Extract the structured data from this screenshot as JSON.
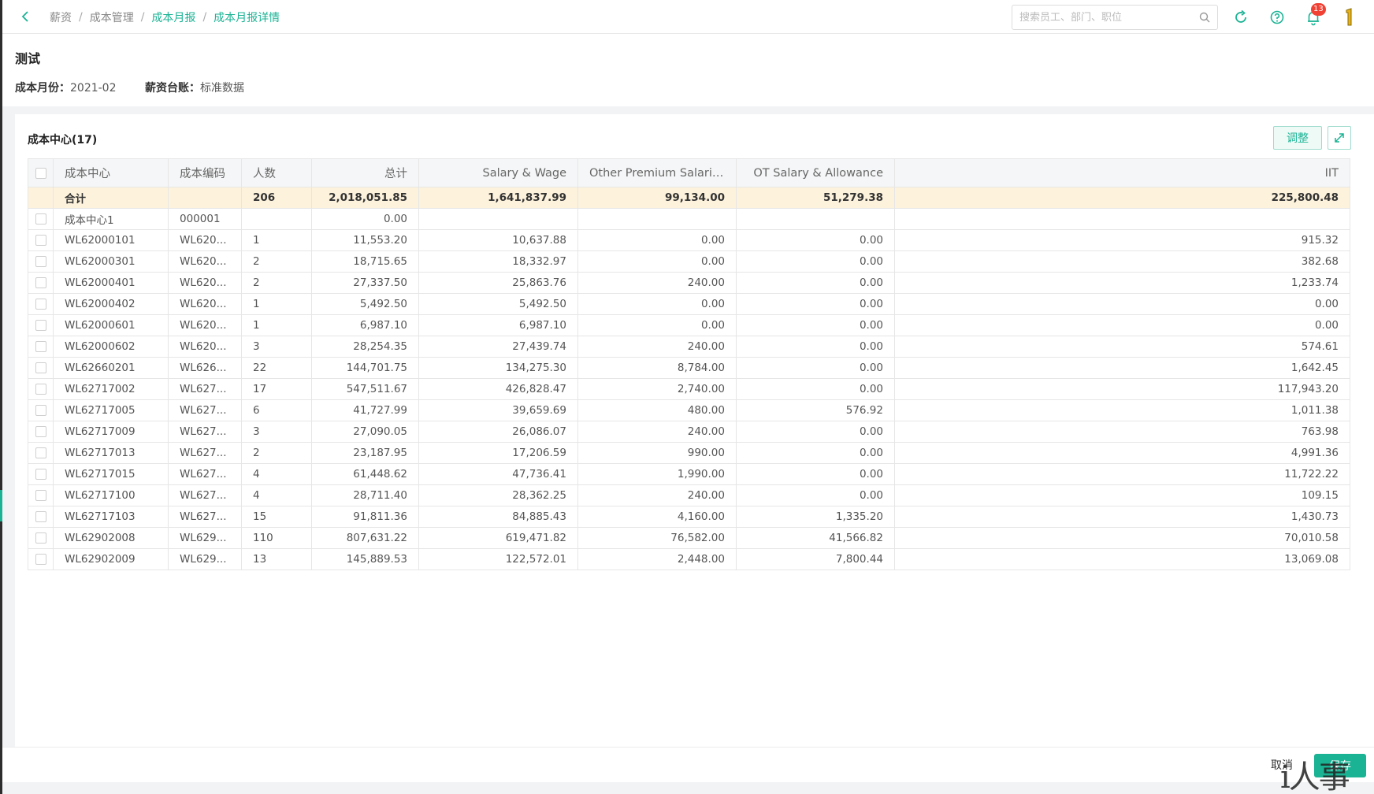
{
  "breadcrumb": [
    "薪资",
    "成本管理",
    "成本月报",
    "成本月报详情"
  ],
  "search": {
    "placeholder": "搜索员工、部门、职位"
  },
  "notifications": {
    "count": "13"
  },
  "page": {
    "title": "测试",
    "month_label": "成本月份：",
    "month_value": "2021-02",
    "ledger_label": "薪资台账：",
    "ledger_value": "标准数据"
  },
  "panel": {
    "title": "成本中心(17)",
    "adjust_label": "调整"
  },
  "table": {
    "columns": [
      "成本中心",
      "成本编码",
      "人数",
      "总计",
      "Salary & Wage",
      "Other Premium Salaries",
      "OT Salary & Allowance",
      "IIT"
    ],
    "total": [
      "合计",
      "",
      "206",
      "2,018,051.85",
      "1,641,837.99",
      "99,134.00",
      "51,279.38",
      "225,800.48"
    ],
    "rows": [
      [
        "成本中心1",
        "000001",
        "",
        "0.00",
        "",
        "",
        "",
        ""
      ],
      [
        "WL62000101",
        "WL620...",
        "1",
        "11,553.20",
        "10,637.88",
        "0.00",
        "0.00",
        "915.32"
      ],
      [
        "WL62000301",
        "WL620...",
        "2",
        "18,715.65",
        "18,332.97",
        "0.00",
        "0.00",
        "382.68"
      ],
      [
        "WL62000401",
        "WL620...",
        "2",
        "27,337.50",
        "25,863.76",
        "240.00",
        "0.00",
        "1,233.74"
      ],
      [
        "WL62000402",
        "WL620...",
        "1",
        "5,492.50",
        "5,492.50",
        "0.00",
        "0.00",
        "0.00"
      ],
      [
        "WL62000601",
        "WL620...",
        "1",
        "6,987.10",
        "6,987.10",
        "0.00",
        "0.00",
        "0.00"
      ],
      [
        "WL62000602",
        "WL620...",
        "3",
        "28,254.35",
        "27,439.74",
        "240.00",
        "0.00",
        "574.61"
      ],
      [
        "WL62660201",
        "WL626...",
        "22",
        "144,701.75",
        "134,275.30",
        "8,784.00",
        "0.00",
        "1,642.45"
      ],
      [
        "WL62717002",
        "WL627...",
        "17",
        "547,511.67",
        "426,828.47",
        "2,740.00",
        "0.00",
        "117,943.20"
      ],
      [
        "WL62717005",
        "WL627...",
        "6",
        "41,727.99",
        "39,659.69",
        "480.00",
        "576.92",
        "1,011.38"
      ],
      [
        "WL62717009",
        "WL627...",
        "3",
        "27,090.05",
        "26,086.07",
        "240.00",
        "0.00",
        "763.98"
      ],
      [
        "WL62717013",
        "WL627...",
        "2",
        "23,187.95",
        "17,206.59",
        "990.00",
        "0.00",
        "4,991.36"
      ],
      [
        "WL62717015",
        "WL627...",
        "4",
        "61,448.62",
        "47,736.41",
        "1,990.00",
        "0.00",
        "11,722.22"
      ],
      [
        "WL62717100",
        "WL627...",
        "4",
        "28,711.40",
        "28,362.25",
        "240.00",
        "0.00",
        "109.15"
      ],
      [
        "WL62717103",
        "WL627...",
        "15",
        "91,811.36",
        "84,885.43",
        "4,160.00",
        "1,335.20",
        "1,430.73"
      ],
      [
        "WL62902008",
        "WL629...",
        "110",
        "807,631.22",
        "619,471.82",
        "76,582.00",
        "41,566.82",
        "70,010.58"
      ],
      [
        "WL62902009",
        "WL629...",
        "13",
        "145,889.53",
        "122,572.01",
        "2,448.00",
        "7,800.44",
        "13,069.08"
      ]
    ]
  },
  "footer": {
    "cancel_label": "取消",
    "save_label": "保存"
  },
  "watermark": "i人事",
  "colors": {
    "accent": "#1ab394",
    "total_row": "#fdf2dc",
    "badge": "#f04134"
  }
}
